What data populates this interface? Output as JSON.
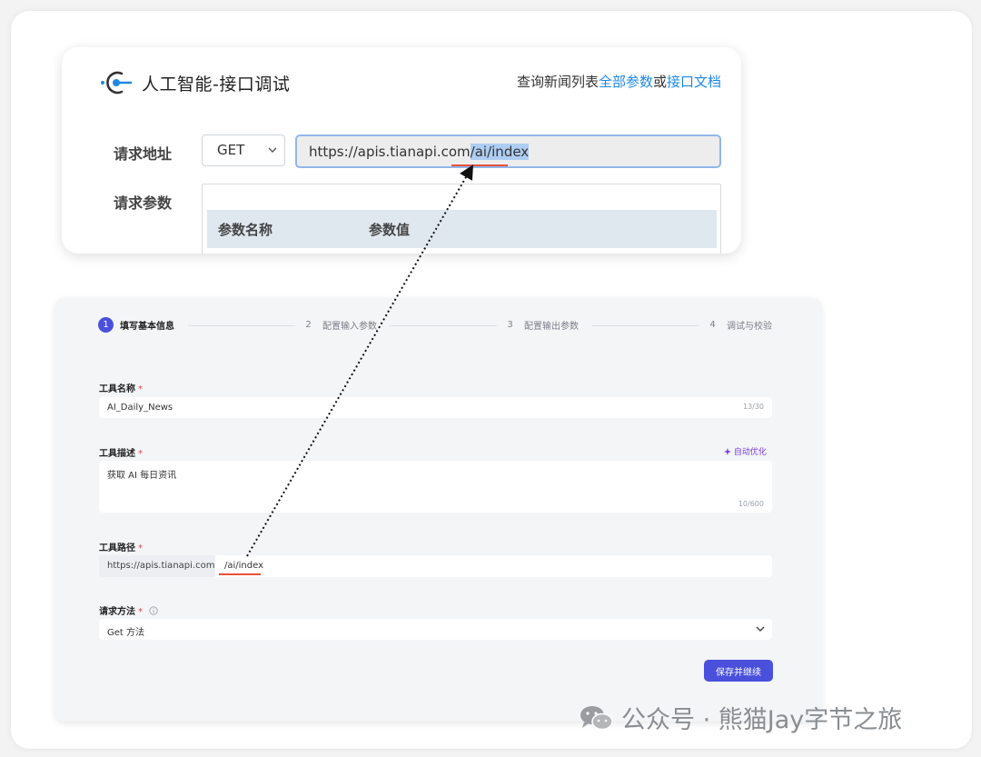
{
  "api_panel": {
    "title": "人工智能-接口调试",
    "links": {
      "prefix": "查询新闻列表",
      "all_params": "全部参数",
      "or": "或",
      "docs": "接口文档"
    },
    "request_url_label": "请求地址",
    "method": "GET",
    "url_base": "https://apis.tianapi.com",
    "url_path": "/ai/index",
    "request_params_label": "请求参数",
    "param_name_header": "参数名称",
    "param_value_header": "参数值"
  },
  "form": {
    "steps": [
      {
        "num": "1",
        "label": "填写基本信息",
        "active": true
      },
      {
        "num": "2",
        "label": "配置输入参数",
        "active": false
      },
      {
        "num": "3",
        "label": "配置输出参数",
        "active": false
      },
      {
        "num": "4",
        "label": "调试与校验",
        "active": false
      }
    ],
    "tool_name": {
      "label": "工具名称",
      "required_mark": "*",
      "value": "AI_Daily_News",
      "counter": "13/30"
    },
    "tool_desc": {
      "label": "工具描述",
      "required_mark": "*",
      "value": "获取 AI 每日资讯",
      "counter": "10/600",
      "auto_optimize": "自动优化"
    },
    "tool_path": {
      "label": "工具路径",
      "required_mark": "*",
      "prefix": "https://apis.tianapi.com",
      "value": "/ai/index"
    },
    "request_method": {
      "label": "请求方法",
      "required_mark": "*",
      "value": "Get 方法"
    },
    "save_button": "保存并继续"
  },
  "watermark": {
    "text": "公众号 · 熊猫Jay字节之旅"
  },
  "colors": {
    "accent_blue": "#1e88e5",
    "primary_button": "#4a50db",
    "highlight": "#aecdf2",
    "required_red": "#e5484d",
    "underline_red": "#e8503a",
    "auto_optimize_purple": "#7b3fe0"
  },
  "icons": {
    "logo": "api-debug-logo-icon",
    "method_dropdown": "chevron-down-icon",
    "request_method_dropdown": "chevron-down-icon",
    "auto_optimize": "sparkle-icon",
    "info": "info-icon",
    "watermark": "wechat-icon"
  }
}
